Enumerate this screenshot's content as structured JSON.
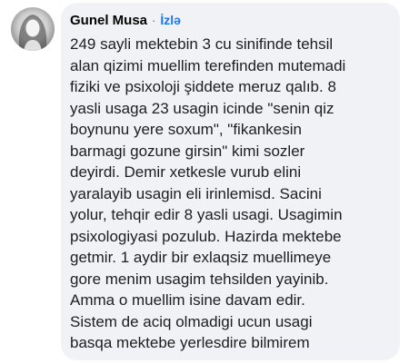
{
  "comment": {
    "author": "Gunel Musa",
    "separator": "·",
    "follow_label": "İzlə",
    "avatar_icon": "profile-photo-icon",
    "colors": {
      "bubble": "#f0f2f5",
      "link": "#1877f2",
      "text": "#1c1e21"
    },
    "text_lines": [
      "249 sayli mektebin 3 cu sinifinde tehsil",
      "alan qizimi muellim terefinden mutemadi",
      "fiziki ve psixoloji şiddete meruz qalıb. 8",
      "yasli usaga 23 usagin icinde \"senin qiz",
      "boynunu yere soxum\", \"fikankesin",
      "barmagi gozune girsin\" kimi sozler",
      "deyirdi. Demir xetkesle vurub elini",
      "yaralayib usagin eli irinlemisd. Sacini",
      "yolur, tehqir edir 8 yasli usagi. Usagimin",
      "psixologiyasi pozulub. Hazirda mektebe",
      "getmir. 1 aydir bir exlaqsiz muellimeye",
      "gore menim usagim tehsilden yayinib.",
      "Amma o muellim isine davam edir.",
      "Sistem de aciq olmadigi ucun usagi",
      "basqa mektebe yerlesdire bilmirem"
    ]
  }
}
